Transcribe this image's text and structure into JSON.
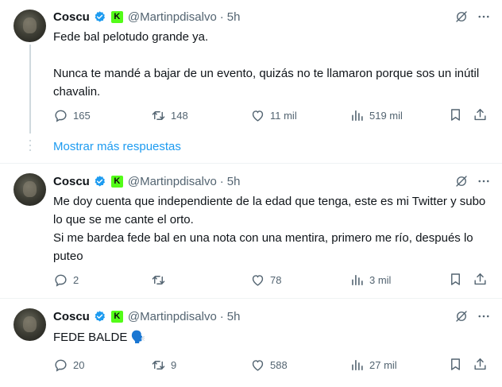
{
  "colors": {
    "accent": "#1d9bf0",
    "muted": "#536471",
    "text": "#0f1419",
    "kick_green": "#53fc18"
  },
  "show_more": "Mostrar más respuestas",
  "tweets": [
    {
      "name": "Coscu",
      "handle": "@Martinpdisalvo",
      "sep": "·",
      "time": "5h",
      "badge": "K",
      "lines": [
        "Fede bal pelotudo grande ya.",
        "",
        "Nunca te mandé a bajar de un evento, quizás no te llamaron porque sos un inútil chavalin."
      ],
      "replies": "165",
      "retweets": "148",
      "likes": "11 mil",
      "views": "519 mil"
    },
    {
      "name": "Coscu",
      "handle": "@Martinpdisalvo",
      "sep": "·",
      "time": "5h",
      "badge": "K",
      "lines": [
        "Me doy cuenta que independiente de la edad que tenga, este es mi Twitter y subo lo que se me cante el orto.",
        "Si me bardea fede bal en una nota con una mentira, primero me río, después lo puteo"
      ],
      "replies": "2",
      "retweets": "",
      "likes": "78",
      "views": "3 mil"
    },
    {
      "name": "Coscu",
      "handle": "@Martinpdisalvo",
      "sep": "·",
      "time": "5h",
      "badge": "K",
      "lines": [
        "FEDE BALDE 🗣️"
      ],
      "replies": "20",
      "retweets": "9",
      "likes": "588",
      "views": "27 mil"
    }
  ]
}
